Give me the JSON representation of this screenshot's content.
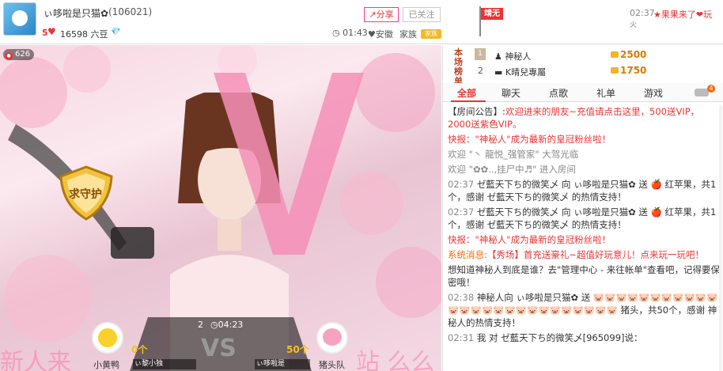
{
  "header": {
    "host_name": "ぃ哆啦是只猫✿",
    "host_id": "(106021)",
    "level": "5",
    "fans_text": "16598 六豆",
    "share_label": "分享",
    "follow_label": "已关注",
    "clock": "01:43",
    "region": "安徽",
    "family": "家族",
    "family_tag": "家族",
    "flag_label": "靖无",
    "ticker_time": "02:37",
    "ticker_text": "★果果来了❤玩",
    "ticker_sub": "火"
  },
  "video": {
    "viewer_count": "626",
    "guard_text": "求守护",
    "side_left": "新人来",
    "side_right": "站 么么",
    "pk": {
      "round": "2",
      "timer": "04:23",
      "vs": "VS",
      "left_count": "0个",
      "right_count": "50个",
      "left_team": "小黄鸭",
      "right_team": "猪头队",
      "left_user": "ぃ黎小独",
      "right_user": "ぃ哆啦是"
    }
  },
  "rank": {
    "label": "本场榜单",
    "rows": [
      {
        "num": "1",
        "user": "神秘人",
        "score": "2500"
      },
      {
        "num": "2",
        "user": "K晴兒專屬",
        "score": "1750"
      }
    ]
  },
  "tabs": [
    "全部",
    "聊天",
    "点歌",
    "礼单",
    "游戏"
  ],
  "car_badge": "4",
  "chat": {
    "announce_label": "【房间公告】:",
    "announce_text": "欢迎进来的朋友~充值请点击这里，500送VIP，2000送紫色VIP。",
    "flash1": "快报：\"神秘人\"成为最新的皇冠粉丝啦！",
    "welcome1": "欢迎 \"丶 龍悦_强管家\" 大驾光临",
    "welcome2": "欢迎 \"✿✿..,挂尸中♬\" 进入房间",
    "gift1_time": "02:37",
    "gift1_text": "ゼ藍天下ち的微笑乄 向 ぃ哆啦是只猫✿ 送 🍎 红苹果，共1个，感谢 ゼ藍天下ち的微笑乄 的热情支持！",
    "gift2_time": "02:37",
    "gift2_text": "ゼ藍天下ち的微笑乄 向 ぃ哆啦是只猫✿ 送 🍎 红苹果，共1个，感谢 ゼ藍天下ち的微笑乄 的热情支持！",
    "flash2": "快报：\"神秘人\"成为最新的皇冠粉丝啦！",
    "sys_label": "系统消息:",
    "sys_text": "【秀场】首充送豪礼~超值好玩意儿！点来玩一玩吧！",
    "tip_text": "想知道神秘人到底是谁？去\"管理中心 - 来往帐单\"查看吧，记得要保密哦！",
    "gift3_time": "02:38",
    "gift3_text": "神秘人向 ぃ哆啦是只猫✿ 送 🐷🐷🐷🐷🐷🐷🐷🐷🐷🐷🐷🐷🐷🐷🐷🐷🐷🐷🐷🐷🐷🐷🐷🐷🐷🐷 猪头，共50个，感谢 神秘人的热情支持！",
    "last_time": "02:31",
    "last_text": "我 对 ゼ藍天下ち的微笑乄[965099]说："
  }
}
